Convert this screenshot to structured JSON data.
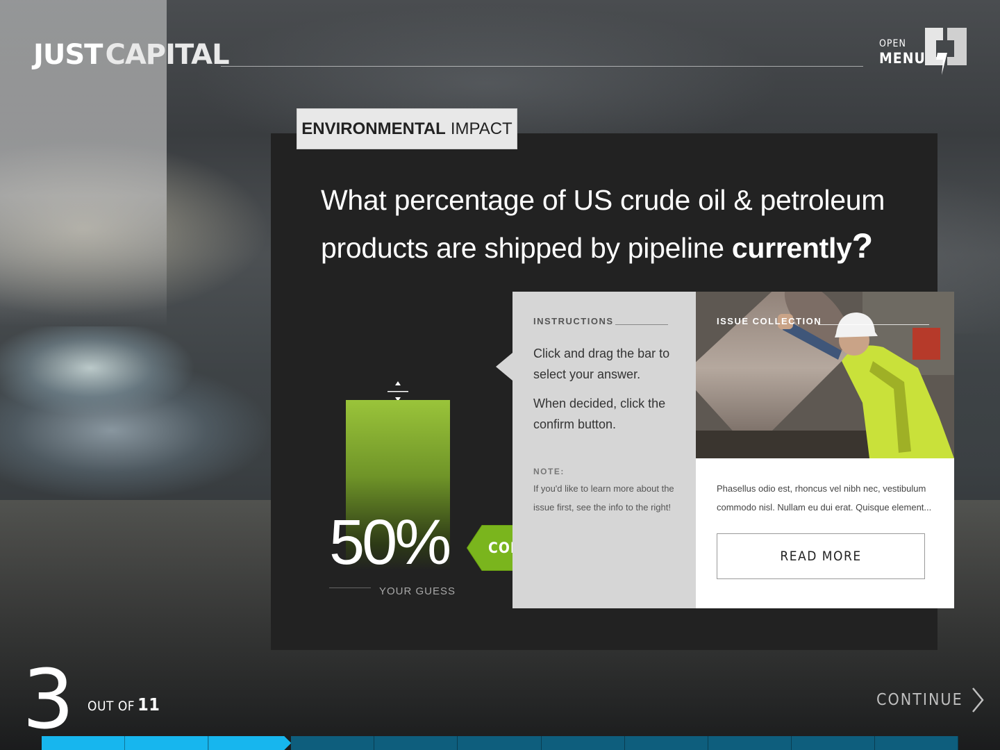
{
  "brand": {
    "logo_part1": "JUST",
    "logo_part2": "CAPITAL"
  },
  "menu": {
    "open_label": "OPEN",
    "menu_label": "MENU"
  },
  "category": {
    "bold": "ENVIRONMENTAL",
    "light": "IMPACT"
  },
  "question": {
    "line1": "What percentage of US crude oil & petroleum",
    "line2_prefix": "products are shipped by pipeline",
    "line2_bold": "currently",
    "qmark": "?"
  },
  "guess": {
    "value": "50%",
    "fraction": 0.5,
    "label": "YOUR GUESS",
    "bar_color_top": "#9ac43a"
  },
  "confirm": {
    "label": "CONFIRM ANSWER",
    "color": "#7ab51d"
  },
  "instructions": {
    "heading": "INSTRUCTIONS",
    "text1": "Click and drag the bar to select your answer.",
    "text2": "When decided, click the confirm button.",
    "note_heading": "NOTE:",
    "note_text": "If you'd like to learn more about the issue first, see the info to the right!"
  },
  "issue": {
    "heading": "ISSUE COLLECTION",
    "text": "Phasellus odio est, rhoncus vel nibh nec, vestibulum commodo nisl. Nullam eu dui erat. Quisque element...",
    "read_more": "READ MORE"
  },
  "footer": {
    "current_step": "3",
    "out_of_label": "OUT OF",
    "total_steps": "11",
    "continue_label": "CONTINUE",
    "progress_current": 3,
    "progress_total": 11,
    "progress_color": "#17b6ee"
  }
}
